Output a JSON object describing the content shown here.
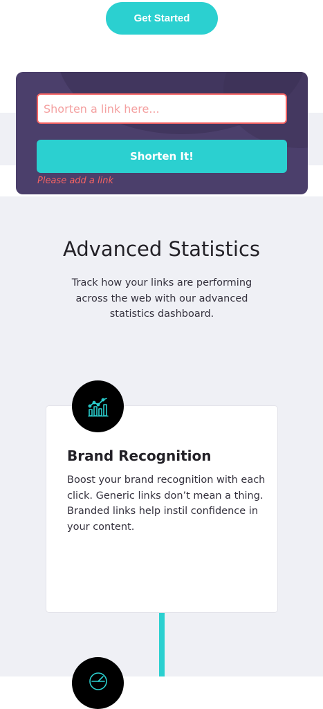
{
  "header": {
    "get_started_label": "Get Started"
  },
  "shortener": {
    "placeholder": "Shorten a link here...",
    "value": "",
    "button_label": "Shorten It!",
    "error_message": "Please add a link"
  },
  "statistics": {
    "title": "Advanced Statistics",
    "description": "Track how your links are performing across the web with our advanced statistics dashboard."
  },
  "cards": [
    {
      "icon": "brand-recognition-chart-icon",
      "title": "Brand Recognition",
      "text": "Boost your brand recognition with each click. Generic links don’t mean a thing. Branded links help instil confidence in your content."
    },
    {
      "icon": "detailed-records-gauge-icon"
    }
  ],
  "colors": {
    "cyan": "#2bd0d0",
    "dark_violet": "#4b3f6b",
    "red": "#f46363",
    "gray_bg": "#eff0f5",
    "very_dark": "#232127"
  }
}
